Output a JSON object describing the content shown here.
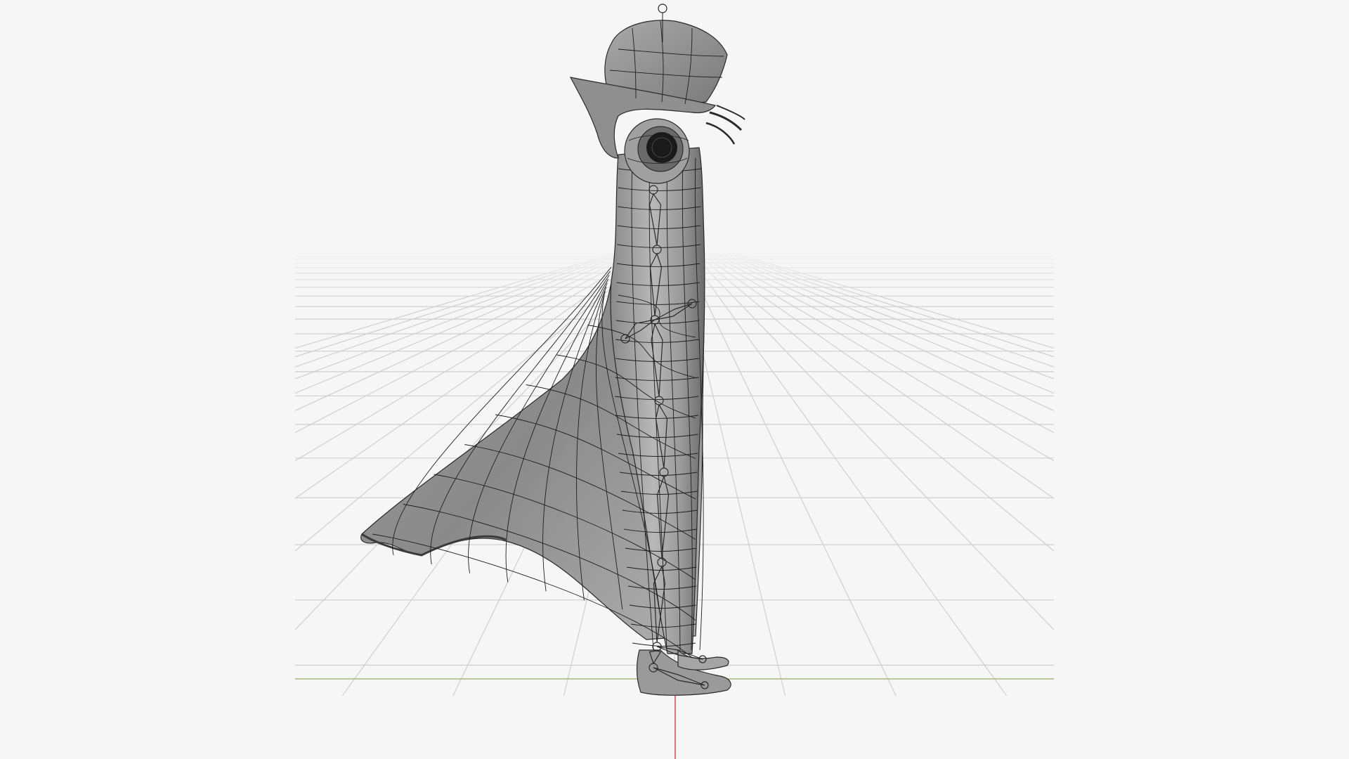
{
  "viewport": {
    "background": "#f6f6f6",
    "grid_color": "#cfcfcf",
    "horizon_fade": "#f6f6f6",
    "floor_line_color": "#a8b878",
    "z_axis_color": "#c8485a",
    "mesh_fill_light": "#b4b4b4",
    "mesh_fill_dark": "#5f5f5f",
    "wire_color": "#1e1e1e"
  },
  "scene": {
    "character": "character-mesh",
    "armature": "armature-bones",
    "hat": "top-hat-mesh",
    "eye": "eye-mesh",
    "feet": "feet-mesh"
  }
}
